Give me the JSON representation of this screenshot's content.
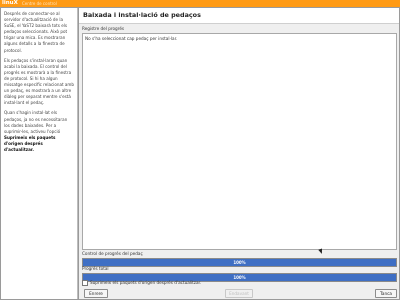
{
  "app": {
    "logo": "linuX",
    "title": "Centre de control"
  },
  "help": {
    "paragraphs": [
      "Després de connectar-se al servidor d'actualització de la SuSE, el YaST2 baixarà tots els pedaços seleccionats. Això pot trigar una mica. Es mostraran alguns detalls a la finestra de protocol.",
      "Els pedaços s'instal·laran quan acabi la baixada. El control del progrés es mostrarà a la finestra de protocol. Si hi ha algun missatge específic relacionat amb un pedaç, es mostrarà a un altre diàleg per separat mentre s'està instal·lant el pedaç.",
      "Quan s'hagin instal·lat els pedaços, ja no es necessitaran los dades baixades. Per a suprimir-les, activeu l'opció"
    ],
    "bold": "Suprimeix els paquets d'origen després d'actualitzar."
  },
  "main": {
    "heading": "Baixada i instal·lació de pedaços",
    "log_label": "Registre del progrés",
    "log_message": "No s'ha seleccionat cap pedaç per instal·lar.",
    "patch_progress_label": "Control de progrés del pedaç",
    "patch_progress": 100,
    "patch_progress_text": "100%",
    "total_progress_label": "Progrés total",
    "total_progress": 100,
    "total_progress_text": "100%",
    "checkbox_label": "Suprimeix els paquets d'origen després d'actualitzar.",
    "checkbox_checked": false
  },
  "buttons": {
    "back": "Enrere",
    "next": "Endavant",
    "close": "Tanca"
  },
  "colors": {
    "accent": "#ff9a14",
    "progress": "#3f6fc4"
  }
}
